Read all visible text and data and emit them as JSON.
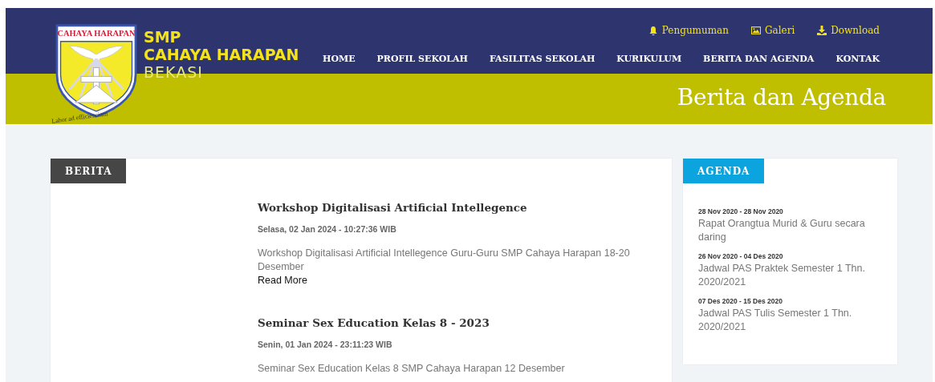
{
  "logo": {
    "banner": "CAHAYA HARAPAN",
    "motto": "Labor ad efficienciam"
  },
  "brand": {
    "line_1": "SMP",
    "line_2": "CAHAYA HARAPAN",
    "line_3": "BEKASI"
  },
  "top_links": [
    {
      "kind": "bell",
      "label": "Pengumuman"
    },
    {
      "kind": "image",
      "label": "Galeri"
    },
    {
      "kind": "download",
      "label": "Download"
    }
  ],
  "nav": [
    {
      "label": "HOME",
      "selected": false
    },
    {
      "label": "PROFIL SEKOLAH",
      "selected": false
    },
    {
      "label": "FASILITAS SEKOLAH",
      "selected": false
    },
    {
      "label": "KURIKULUM",
      "selected": false
    },
    {
      "label": "BERITA DAN AGENDA",
      "selected": false
    },
    {
      "label": "KONTAK",
      "selected": false
    }
  ],
  "page_title": "Berita dan Agenda",
  "berita": {
    "heading": "BERITA",
    "posts": [
      {
        "title": "Workshop Digitalisasi Artificial Intellegence",
        "date": "Selasa, 02 Jan 2024 - 10:27:36 WIB",
        "excerpt": "Workshop Digitalisasi Artificial Intellegence Guru-Guru SMP Cahaya Harapan 18-20 Desember",
        "link": "Read More"
      },
      {
        "title": "Seminar Sex Education Kelas 8 - 2023",
        "date": "Senin, 01 Jan 2024 - 23:11:23 WIB",
        "excerpt": "Seminar Sex Education Kelas 8 SMP Cahaya Harapan 12 Desember"
      }
    ]
  },
  "agenda": {
    "heading": "AGENDA",
    "items": [
      {
        "dates": "28 Nov 2020 - 28 Nov 2020",
        "title": "Rapat Orangtua Murid & Guru secara daring"
      },
      {
        "dates": "26 Nov 2020 - 04 Des 2020",
        "title": "Jadwal PAS Praktek Semester 1 Thn. 2020/2021"
      },
      {
        "dates": "07 Des 2020 - 15 Des 2020",
        "title": "Jadwal PAS Tulis Semester 1 Thn. 2020/2021"
      }
    ]
  }
}
